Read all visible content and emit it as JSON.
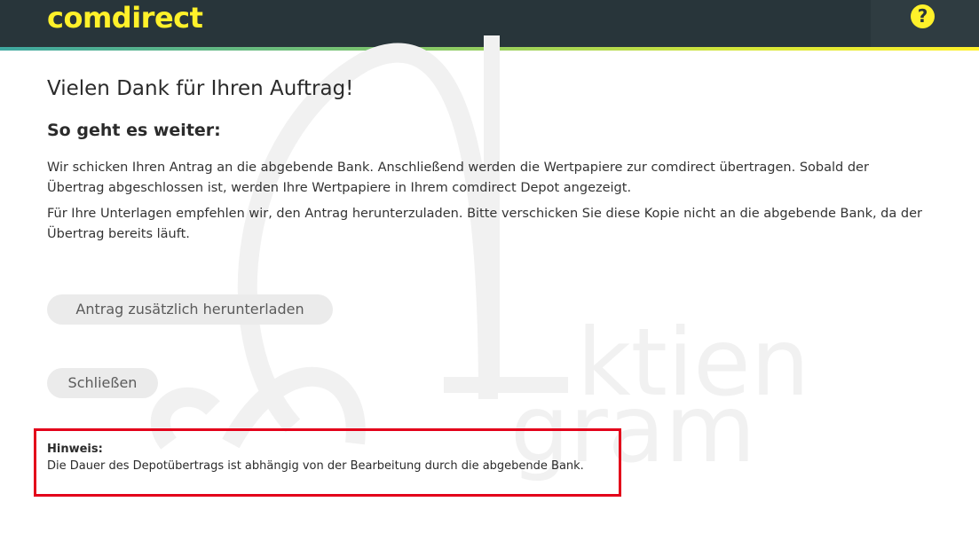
{
  "header": {
    "logo_text": "comdirect",
    "help_symbol": "?",
    "help_icon": "question-circle-icon",
    "colors": {
      "background": "#28353a",
      "brand_yellow": "#fff12a"
    }
  },
  "main": {
    "title": "Vielen Dank für Ihren Auftrag!",
    "subtitle": "So geht es weiter:",
    "paragraph_1": "Wir schicken Ihren Antrag an die abgebende Bank. Anschließend werden die Wertpapiere zur comdirect übertragen. Sobald der Übertrag abgeschlossen ist, werden Ihre Wertpapiere in Ihrem comdirect Depot angezeigt.",
    "paragraph_2": "Für Ihre Unterlagen empfehlen wir, den Antrag herunterzuladen. Bitte verschicken Sie diese Kopie nicht an die abgebende Bank, da der Übertrag bereits läuft.",
    "download_button_label": "Antrag zusätzlich herunterladen",
    "close_button_label": "Schließen"
  },
  "notice": {
    "title": "Hinweis:",
    "text": "Die Dauer des Depotübertrags ist abhängig von der Bearbeitung durch die abgebende Bank.",
    "border_color": "#e3001a"
  },
  "watermark": {
    "line_1": "ktien",
    "line_2": "gram"
  }
}
